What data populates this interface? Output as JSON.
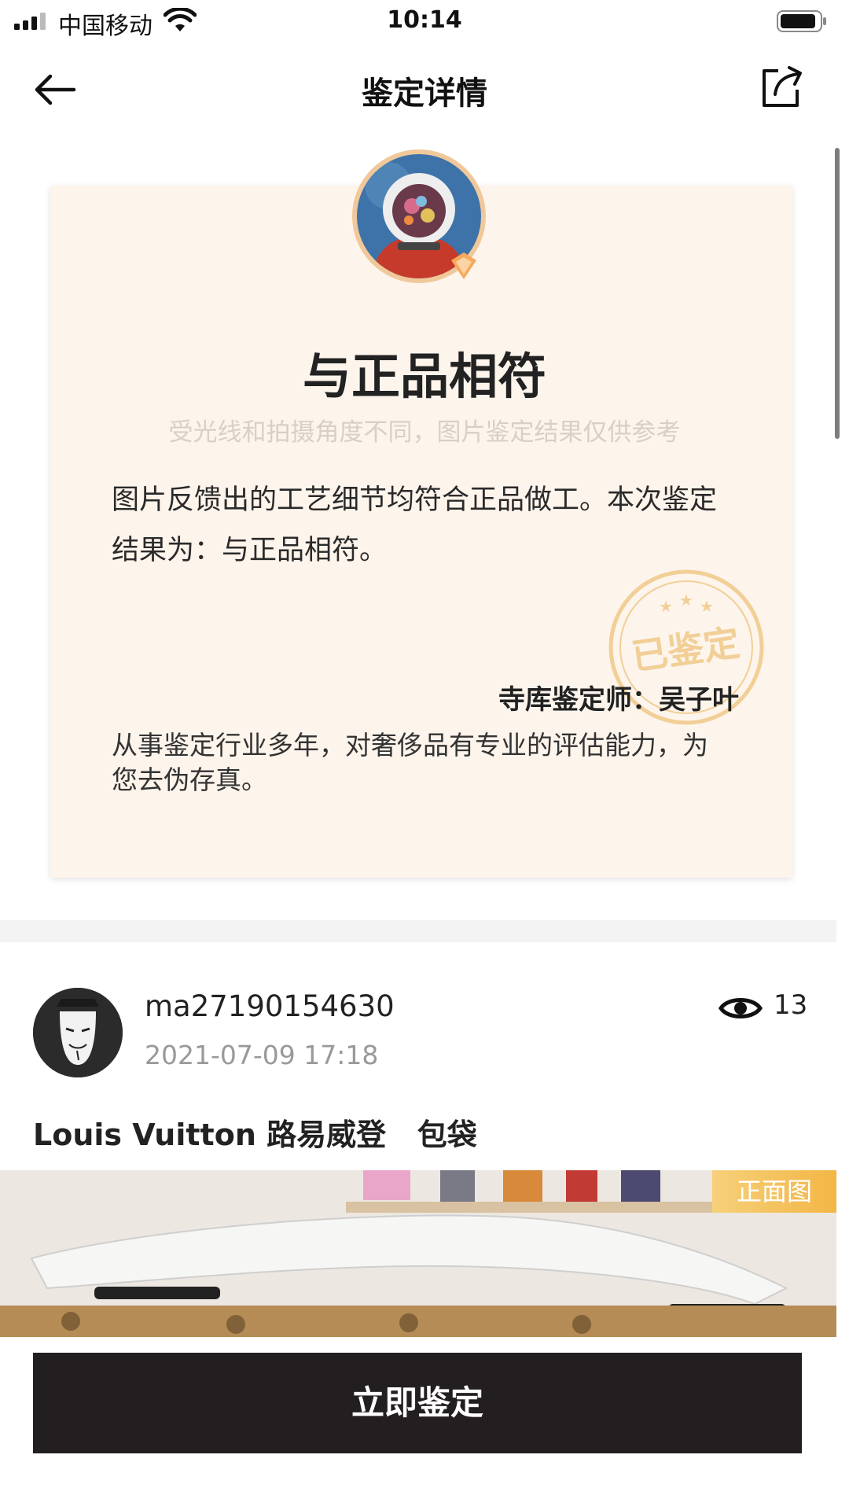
{
  "status_bar": {
    "carrier": "中国移动",
    "time": "10:14"
  },
  "nav": {
    "title": "鉴定详情"
  },
  "result": {
    "title": "与正品相符",
    "subtitle": "受光线和拍摄角度不同，图片鉴定结果仅供参考",
    "description": "图片反馈出的工艺细节均符合正品做工。本次鉴定结果为：与正品相符。",
    "stamp_text": "已鉴定",
    "appraiser_line": "寺库鉴定师：吴子叶",
    "appraiser_desc": "从事鉴定行业多年，对奢侈品有专业的评估能力，为您去伪存真。"
  },
  "post": {
    "username": "ma27190154630",
    "time": "2021-07-09 17:18",
    "views": "13",
    "product_title": "Louis Vuitton 路易威登   包袋",
    "photo_tag": "正面图"
  },
  "cta": {
    "label": "立即鉴定"
  },
  "colors": {
    "card_bg": "#fdf4ec",
    "cta_bg": "#231e1f",
    "tag_gold": "#f3b646",
    "stamp_gold": "#f1cf96"
  },
  "icons": {
    "back": "arrow-left-icon",
    "share": "share-icon",
    "views": "eye-icon",
    "verified": "verified-badge-icon"
  }
}
